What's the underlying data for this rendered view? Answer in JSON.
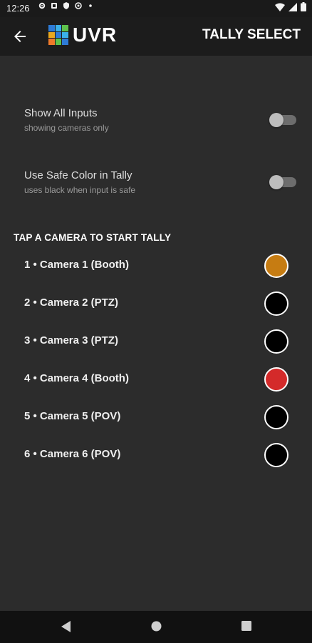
{
  "status": {
    "time": "12:26",
    "icons": [
      "settings-icon",
      "notification-icon",
      "shield-icon",
      "vpn-icon",
      "dot-icon"
    ],
    "right_icons": [
      "wifi-icon",
      "signal-icon",
      "battery-icon"
    ]
  },
  "header": {
    "logo_text": "UVR",
    "title": "TALLY SELECT",
    "logo_colors": [
      "#2e7bd6",
      "#3bb0e8",
      "#5ec24b",
      "#e9a81e",
      "#2e7bd6",
      "#3bb0e8",
      "#f07a2a",
      "#5ec24b",
      "#2e7bd6"
    ]
  },
  "settings": [
    {
      "label": "Show All Inputs",
      "subtitle": "showing cameras only",
      "enabled": false
    },
    {
      "label": "Use Safe Color in Tally",
      "subtitle": "uses black when input is safe",
      "enabled": false
    }
  ],
  "section_header": "TAP A CAMERA TO START TALLY",
  "cameras": [
    {
      "label": "1  •  Camera 1 (Booth)",
      "tally_color": "#c67c12"
    },
    {
      "label": "2  •  Camera 2 (PTZ)",
      "tally_color": "#000000"
    },
    {
      "label": "3  •  Camera 3 (PTZ)",
      "tally_color": "#000000"
    },
    {
      "label": "4  •  Camera 4 (Booth)",
      "tally_color": "#d42a2a"
    },
    {
      "label": "5  •  Camera 5 (POV)",
      "tally_color": "#000000"
    },
    {
      "label": "6  •  Camera 6 (POV)",
      "tally_color": "#000000"
    }
  ],
  "navbar": {
    "buttons": [
      "back-nav-icon",
      "home-nav-icon",
      "recents-nav-icon"
    ]
  }
}
